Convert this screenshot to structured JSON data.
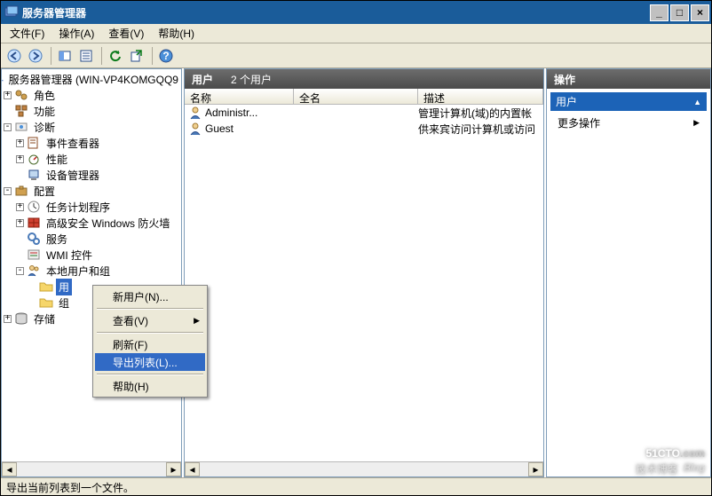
{
  "window": {
    "title": "服务器管理器"
  },
  "menu": {
    "file": "文件(F)",
    "action": "操作(A)",
    "view": "查看(V)",
    "help": "帮助(H)"
  },
  "tree": {
    "root": "服务器管理器 (WIN-VP4KOMGQQ9",
    "roles": "角色",
    "features": "功能",
    "diag": "诊断",
    "evtviewer": "事件查看器",
    "perf": "性能",
    "devmgr": "设备管理器",
    "config": "配置",
    "tasksched": "任务计划程序",
    "advfw": "高级安全 Windows 防火墙",
    "services": "服务",
    "wmi": "WMI 控件",
    "lusrmgr": "本地用户和组",
    "users": "用",
    "groups": "组",
    "storage": "存储"
  },
  "mid": {
    "title": "用户",
    "count": "2 个用户",
    "col_name": "名称",
    "col_fullname": "全名",
    "col_desc": "描述",
    "rows": [
      {
        "name": "Administr...",
        "fullname": "",
        "desc": "管理计算机(域)的内置帐"
      },
      {
        "name": "Guest",
        "fullname": "",
        "desc": "供来宾访问计算机或访问"
      }
    ]
  },
  "actions": {
    "header": "操作",
    "group": "用户",
    "more": "更多操作"
  },
  "context_menu": {
    "new_user": "新用户(N)...",
    "view": "查看(V)",
    "refresh": "刷新(F)",
    "export": "导出列表(L)...",
    "help": "帮助(H)"
  },
  "statusbar": {
    "text": "导出当前列表到一个文件。"
  },
  "watermark": {
    "brand1": "51CTO",
    "brand2": ".com",
    "sub": "技术博客",
    "blog": "Blog"
  }
}
